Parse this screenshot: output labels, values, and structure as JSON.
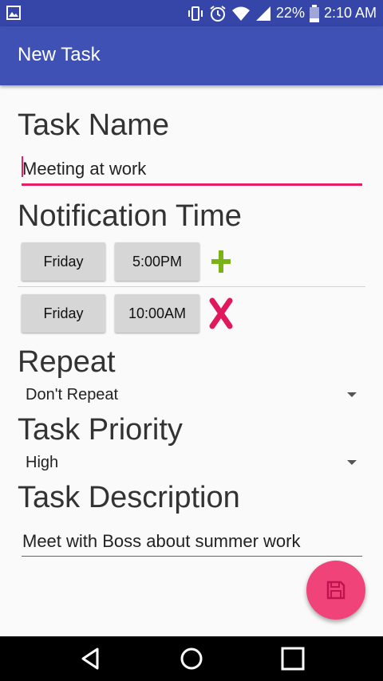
{
  "status_bar": {
    "battery": "22%",
    "time": "2:10 AM"
  },
  "toolbar": {
    "title": "New Task"
  },
  "task_name": {
    "heading": "Task Name",
    "value": "Meeting at work"
  },
  "notification": {
    "heading": "Notification Time",
    "rows": [
      {
        "day": "Friday",
        "time": "5:00PM",
        "action_icon": "plus-icon"
      },
      {
        "day": "Friday",
        "time": "10:00AM",
        "action_icon": "close-icon"
      }
    ]
  },
  "repeat": {
    "heading": "Repeat",
    "selected": "Don't Repeat"
  },
  "priority": {
    "heading": "Task Priority",
    "selected": "High"
  },
  "description": {
    "heading": "Task Description",
    "value": "Meet with Boss about summer work"
  },
  "fab": {
    "icon": "save-icon"
  },
  "colors": {
    "primary": "#3f51b5",
    "primary_dark": "#3546a8",
    "accent": "#e91e63",
    "fab": "#f0437a",
    "plus": "#7ab317",
    "close": "#e0185d"
  }
}
